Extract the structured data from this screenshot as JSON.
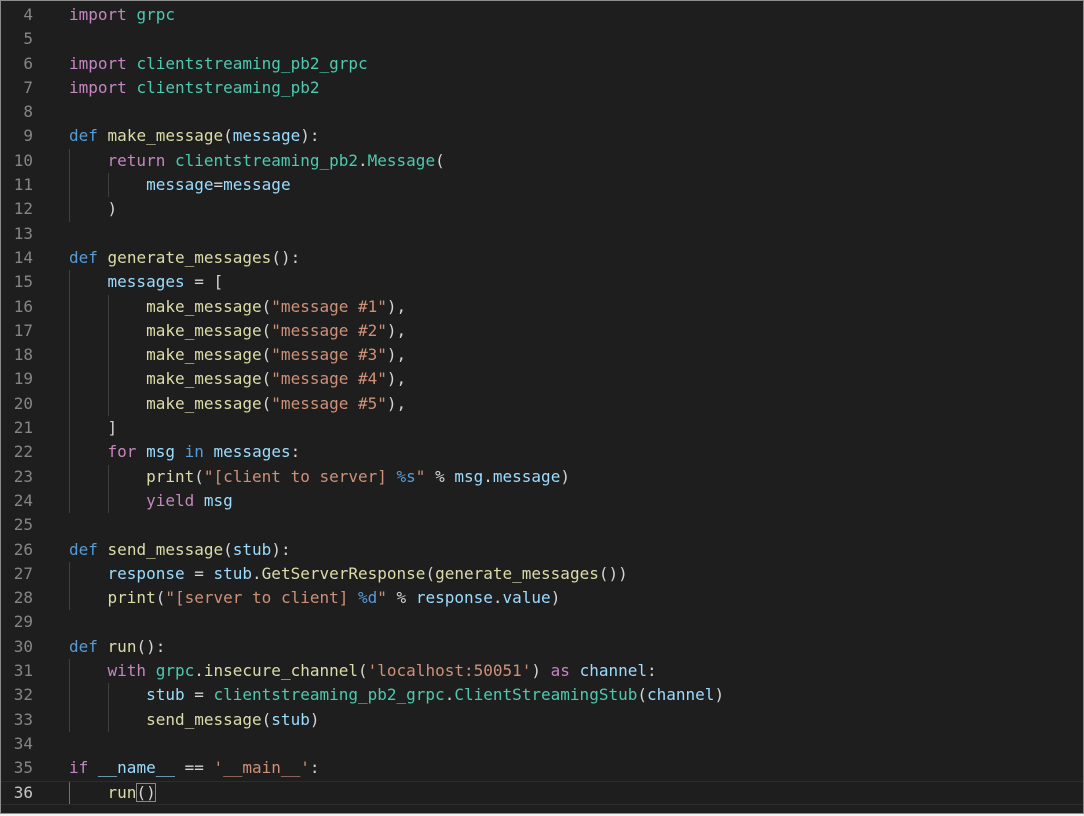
{
  "editor": {
    "language": "python",
    "cursor_line": "36",
    "lines": [
      {
        "n": "4",
        "tokens": [
          [
            "kw",
            "import"
          ],
          [
            "plain",
            " "
          ],
          [
            "mod",
            "grpc"
          ]
        ]
      },
      {
        "n": "5",
        "tokens": []
      },
      {
        "n": "6",
        "tokens": [
          [
            "kw",
            "import"
          ],
          [
            "plain",
            " "
          ],
          [
            "mod",
            "clientstreaming_pb2_grpc"
          ]
        ]
      },
      {
        "n": "7",
        "tokens": [
          [
            "kw",
            "import"
          ],
          [
            "plain",
            " "
          ],
          [
            "mod",
            "clientstreaming_pb2"
          ]
        ]
      },
      {
        "n": "8",
        "tokens": []
      },
      {
        "n": "9",
        "tokens": [
          [
            "kd",
            "def"
          ],
          [
            "plain",
            " "
          ],
          [
            "fn",
            "make_message"
          ],
          [
            "plain",
            "("
          ],
          [
            "var",
            "message"
          ],
          [
            "plain",
            "):"
          ]
        ]
      },
      {
        "n": "10",
        "guides": 1,
        "tokens": [
          [
            "plain",
            "    "
          ],
          [
            "kw",
            "return"
          ],
          [
            "plain",
            " "
          ],
          [
            "mod",
            "clientstreaming_pb2"
          ],
          [
            "plain",
            "."
          ],
          [
            "mod",
            "Message"
          ],
          [
            "plain",
            "("
          ]
        ]
      },
      {
        "n": "11",
        "guides": 2,
        "tokens": [
          [
            "plain",
            "        "
          ],
          [
            "var",
            "message"
          ],
          [
            "plain",
            "="
          ],
          [
            "var",
            "message"
          ]
        ]
      },
      {
        "n": "12",
        "guides": 1,
        "tokens": [
          [
            "plain",
            "    )"
          ]
        ]
      },
      {
        "n": "13",
        "tokens": []
      },
      {
        "n": "14",
        "tokens": [
          [
            "kd",
            "def"
          ],
          [
            "plain",
            " "
          ],
          [
            "fn",
            "generate_messages"
          ],
          [
            "plain",
            "():"
          ]
        ]
      },
      {
        "n": "15",
        "guides": 1,
        "tokens": [
          [
            "plain",
            "    "
          ],
          [
            "var",
            "messages"
          ],
          [
            "plain",
            " = ["
          ]
        ]
      },
      {
        "n": "16",
        "guides": 2,
        "tokens": [
          [
            "plain",
            "        "
          ],
          [
            "fn",
            "make_message"
          ],
          [
            "plain",
            "("
          ],
          [
            "str",
            "\"message #1\""
          ],
          [
            "plain",
            "),"
          ]
        ]
      },
      {
        "n": "17",
        "guides": 2,
        "tokens": [
          [
            "plain",
            "        "
          ],
          [
            "fn",
            "make_message"
          ],
          [
            "plain",
            "("
          ],
          [
            "str",
            "\"message #2\""
          ],
          [
            "plain",
            "),"
          ]
        ]
      },
      {
        "n": "18",
        "guides": 2,
        "tokens": [
          [
            "plain",
            "        "
          ],
          [
            "fn",
            "make_message"
          ],
          [
            "plain",
            "("
          ],
          [
            "str",
            "\"message #3\""
          ],
          [
            "plain",
            "),"
          ]
        ]
      },
      {
        "n": "19",
        "guides": 2,
        "tokens": [
          [
            "plain",
            "        "
          ],
          [
            "fn",
            "make_message"
          ],
          [
            "plain",
            "("
          ],
          [
            "str",
            "\"message #4\""
          ],
          [
            "plain",
            "),"
          ]
        ]
      },
      {
        "n": "20",
        "guides": 2,
        "tokens": [
          [
            "plain",
            "        "
          ],
          [
            "fn",
            "make_message"
          ],
          [
            "plain",
            "("
          ],
          [
            "str",
            "\"message #5\""
          ],
          [
            "plain",
            "),"
          ]
        ]
      },
      {
        "n": "21",
        "guides": 1,
        "tokens": [
          [
            "plain",
            "    ]"
          ]
        ]
      },
      {
        "n": "22",
        "guides": 1,
        "tokens": [
          [
            "plain",
            "    "
          ],
          [
            "kw",
            "for"
          ],
          [
            "plain",
            " "
          ],
          [
            "var",
            "msg"
          ],
          [
            "plain",
            " "
          ],
          [
            "kd",
            "in"
          ],
          [
            "plain",
            " "
          ],
          [
            "var",
            "messages"
          ],
          [
            "plain",
            ":"
          ]
        ]
      },
      {
        "n": "23",
        "guides": 2,
        "tokens": [
          [
            "plain",
            "        "
          ],
          [
            "fn",
            "print"
          ],
          [
            "plain",
            "("
          ],
          [
            "str",
            "\"[client to server] "
          ],
          [
            "esc",
            "%s"
          ],
          [
            "str",
            "\""
          ],
          [
            "plain",
            " % "
          ],
          [
            "var",
            "msg"
          ],
          [
            "plain",
            "."
          ],
          [
            "var",
            "message"
          ],
          [
            "plain",
            ")"
          ]
        ]
      },
      {
        "n": "24",
        "guides": 2,
        "tokens": [
          [
            "plain",
            "        "
          ],
          [
            "kw",
            "yield"
          ],
          [
            "plain",
            " "
          ],
          [
            "var",
            "msg"
          ]
        ]
      },
      {
        "n": "25",
        "tokens": []
      },
      {
        "n": "26",
        "tokens": [
          [
            "kd",
            "def"
          ],
          [
            "plain",
            " "
          ],
          [
            "fn",
            "send_message"
          ],
          [
            "plain",
            "("
          ],
          [
            "var",
            "stub"
          ],
          [
            "plain",
            "):"
          ]
        ]
      },
      {
        "n": "27",
        "guides": 1,
        "tokens": [
          [
            "plain",
            "    "
          ],
          [
            "var",
            "response"
          ],
          [
            "plain",
            " = "
          ],
          [
            "var",
            "stub"
          ],
          [
            "plain",
            "."
          ],
          [
            "fn",
            "GetServerResponse"
          ],
          [
            "plain",
            "("
          ],
          [
            "fn",
            "generate_messages"
          ],
          [
            "plain",
            "())"
          ]
        ]
      },
      {
        "n": "28",
        "guides": 1,
        "tokens": [
          [
            "plain",
            "    "
          ],
          [
            "fn",
            "print"
          ],
          [
            "plain",
            "("
          ],
          [
            "str",
            "\"[server to client] "
          ],
          [
            "esc",
            "%d"
          ],
          [
            "str",
            "\""
          ],
          [
            "plain",
            " % "
          ],
          [
            "var",
            "response"
          ],
          [
            "plain",
            "."
          ],
          [
            "var",
            "value"
          ],
          [
            "plain",
            ")"
          ]
        ]
      },
      {
        "n": "29",
        "tokens": []
      },
      {
        "n": "30",
        "tokens": [
          [
            "kd",
            "def"
          ],
          [
            "plain",
            " "
          ],
          [
            "fn",
            "run"
          ],
          [
            "plain",
            "():"
          ]
        ]
      },
      {
        "n": "31",
        "guides": 1,
        "tokens": [
          [
            "plain",
            "    "
          ],
          [
            "kw",
            "with"
          ],
          [
            "plain",
            " "
          ],
          [
            "mod",
            "grpc"
          ],
          [
            "plain",
            "."
          ],
          [
            "fn",
            "insecure_channel"
          ],
          [
            "plain",
            "("
          ],
          [
            "str",
            "'localhost:50051'"
          ],
          [
            "plain",
            ") "
          ],
          [
            "kw",
            "as"
          ],
          [
            "plain",
            " "
          ],
          [
            "var",
            "channel"
          ],
          [
            "plain",
            ":"
          ]
        ]
      },
      {
        "n": "32",
        "guides": 2,
        "tokens": [
          [
            "plain",
            "        "
          ],
          [
            "var",
            "stub"
          ],
          [
            "plain",
            " = "
          ],
          [
            "mod",
            "clientstreaming_pb2_grpc"
          ],
          [
            "plain",
            "."
          ],
          [
            "mod",
            "ClientStreamingStub"
          ],
          [
            "plain",
            "("
          ],
          [
            "var",
            "channel"
          ],
          [
            "plain",
            ")"
          ]
        ]
      },
      {
        "n": "33",
        "guides": 2,
        "tokens": [
          [
            "plain",
            "        "
          ],
          [
            "fn",
            "send_message"
          ],
          [
            "plain",
            "("
          ],
          [
            "var",
            "stub"
          ],
          [
            "plain",
            ")"
          ]
        ]
      },
      {
        "n": "34",
        "tokens": []
      },
      {
        "n": "35",
        "tokens": [
          [
            "kw",
            "if"
          ],
          [
            "plain",
            " "
          ],
          [
            "var",
            "__name__"
          ],
          [
            "plain",
            " == "
          ],
          [
            "str",
            "'__main__'"
          ],
          [
            "plain",
            ":"
          ]
        ]
      },
      {
        "n": "36",
        "guides": 1,
        "current": true,
        "tokens": [
          [
            "plain",
            "    "
          ],
          [
            "fn",
            "run"
          ],
          [
            "brk",
            "()"
          ]
        ]
      }
    ]
  },
  "colors": {
    "background": "#1e1e1e",
    "keyword": "#c586c0",
    "def_keyword": "#569cd6",
    "function": "#dcdcaa",
    "module": "#4ec9b0",
    "variable": "#9cdcfe",
    "string": "#ce9178",
    "line_number": "#858585"
  }
}
